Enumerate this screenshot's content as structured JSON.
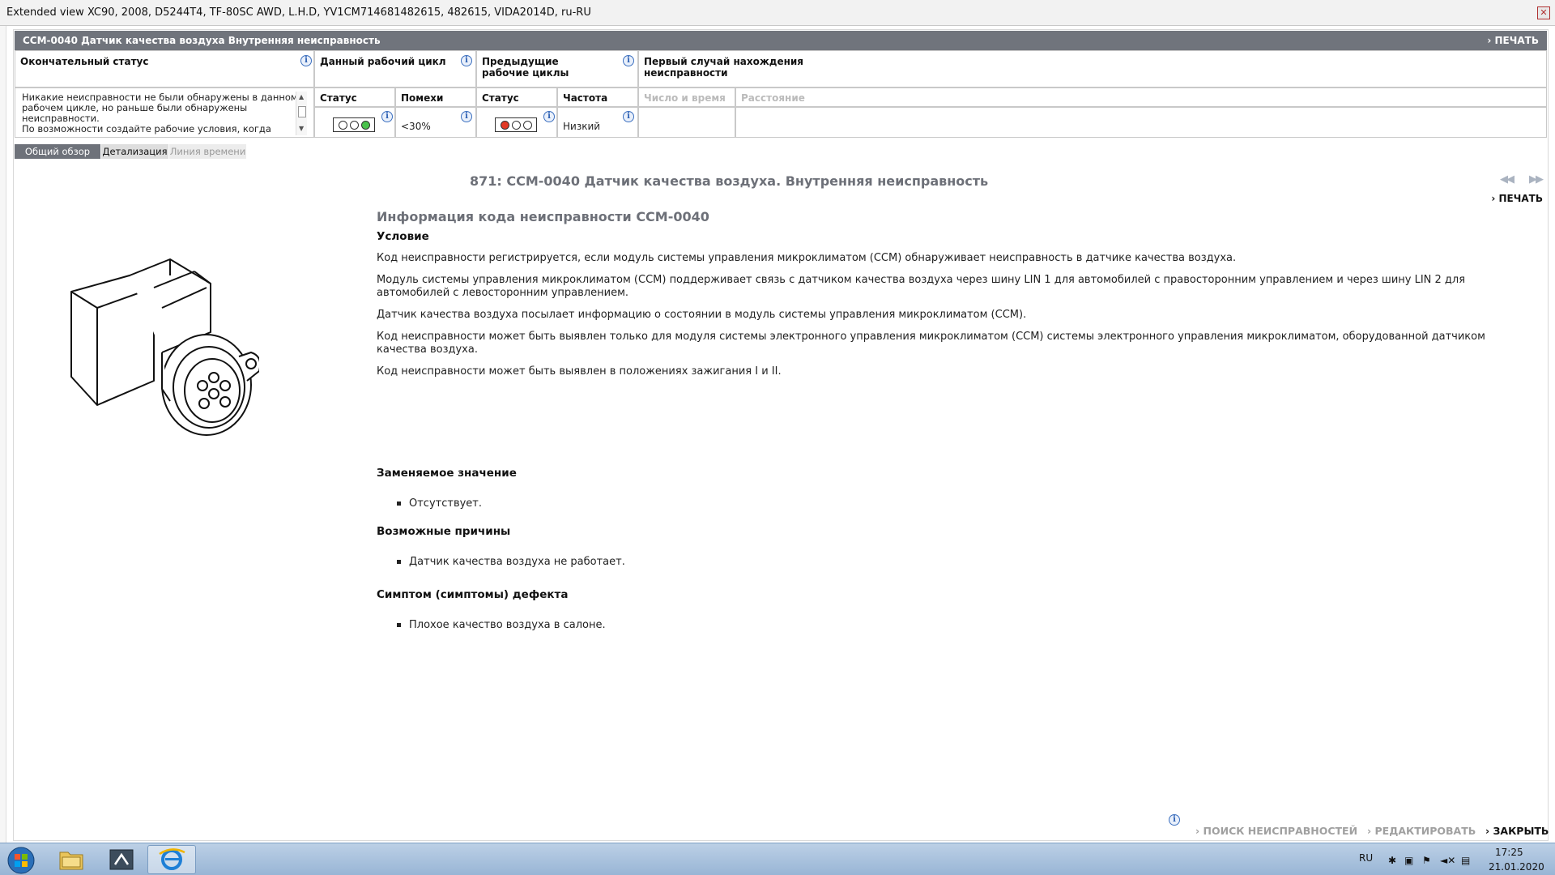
{
  "window": {
    "title": "Extended view   XC90, 2008, D5244T4, TF-80SC AWD, L.H.D, YV1CM714681482615, 482615, VIDA2014D, ru-RU",
    "close_icon": "close-icon"
  },
  "header": {
    "dtc_title": "CCM-0040 Датчик качества воздуха Внутренняя неисправность",
    "print_label": "ПЕЧАТЬ"
  },
  "status": {
    "final_status_label": "Окончательный статус",
    "final_status_text": "Никакие неисправности не были обнаружены в данном рабочем цикле, но раньше были обнаружены неисправности.\nПо возможности создайте рабочие условия, когда",
    "current_cycle_label": "Данный рабочий цикл",
    "previous_cycles_label": "Предыдущие рабочие циклы",
    "first_occurrence_label": "Первый случай нахождения неисправности",
    "status_col": "Статус",
    "interference_col": "Помехи",
    "interference_value": "<30%",
    "frequency_col": "Частота",
    "frequency_value": "Низкий",
    "datetime_col": "Число и время",
    "distance_col": "Расстояние"
  },
  "tabs": [
    {
      "label": "Общий обзор"
    },
    {
      "label": "Детализация"
    },
    {
      "label": "Линия времени"
    }
  ],
  "article": {
    "title": "871: CCM-0040 Датчик качества воздуха. Внутренняя неисправность",
    "print_label": "ПЕЧАТЬ",
    "info_heading": "Информация кода неисправности CCM-0040",
    "condition_heading": "Условие",
    "p1": "Код неисправности регистрируется, если модуль системы управления микроклиматом (CCM) обнаруживает неисправность в датчике качества воздуха.",
    "p2": "Модуль системы управления микроклиматом (CCM) поддерживает связь с датчиком качества воздуха через шину LIN 1 для автомобилей с правосторонним управлением и через шину LIN 2 для автомобилей с левосторонним управлением.",
    "p3": "Датчик качества воздуха посылает информацию о состоянии в модуль системы управления микроклиматом (CCM).",
    "p4": "Код неисправности может быть выявлен только для модуля системы электронного управления микроклиматом (CCM) системы электронного управления микроклиматом, оборудованной датчиком качества воздуха.",
    "p5": "Код неисправности может быть выявлен в положениях зажигания I и II.",
    "replaced_heading": "Заменяемое значение",
    "replaced_item": "Отсутствует.",
    "causes_heading": "Возможные причины",
    "causes_item": "Датчик качества воздуха не работает.",
    "symptom_heading": "Симптом (симптомы) дефекта",
    "symptom_item": "Плохое качество воздуха в салоне."
  },
  "actions": {
    "troubleshoot": "ПОИСК НЕИСПРАВНОСТЕЙ",
    "edit": "РЕДАКТИРОВАТЬ",
    "close": "ЗАКРЫТЬ"
  },
  "taskbar": {
    "lang": "RU",
    "time": "17:25",
    "date": "21.01.2020"
  },
  "colors": {
    "header_bg": "#70747c",
    "lamp_green": "#49c24b",
    "lamp_red": "#e33a26"
  }
}
